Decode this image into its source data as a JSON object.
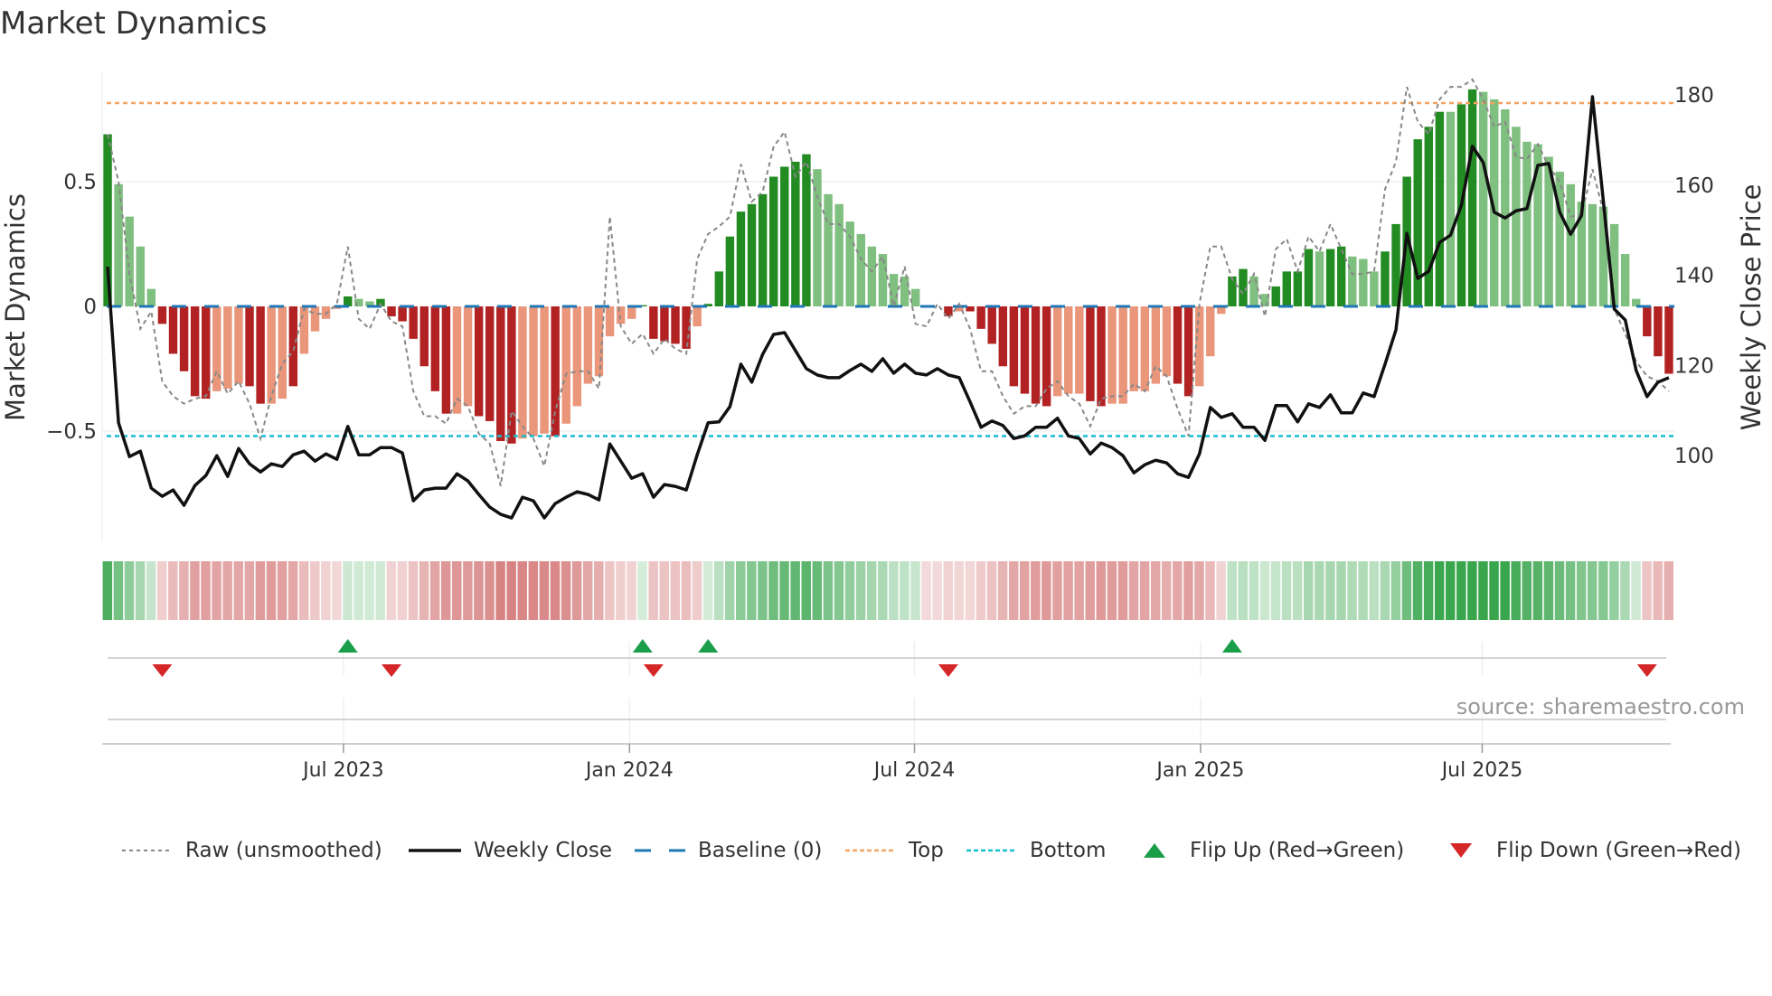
{
  "title": "Market Dynamics",
  "source": "source: sharemaestro.com",
  "legend": {
    "raw": "Raw (unsmoothed)",
    "close": "Weekly Close",
    "baseline": "Baseline (0)",
    "top": "Top",
    "bottom": "Bottom",
    "flip_up": "Flip Up (Red→Green)",
    "flip_down": "Flip Down (Green→Red)"
  },
  "colors": {
    "dark_green": "#228b22",
    "light_green": "#7fbf7f",
    "dark_red": "#b22222",
    "light_red": "#e9967a",
    "close": "#111111",
    "raw": "#888888",
    "baseline": "#1f77b4",
    "top": "#f4a460",
    "bottom": "#17becf",
    "flip_up": "#1a9e4a",
    "flip_down": "#d62728"
  },
  "chart_data": {
    "type": "bar",
    "title": "Market Dynamics",
    "ylabel": "Market Dynamics",
    "y2label": "Weekly Close Price",
    "ylim": [
      -0.94,
      0.93
    ],
    "y2lim": [
      81,
      185
    ],
    "yticks": [
      {
        "v": 0.5,
        "label": "0.5"
      },
      {
        "v": 0,
        "label": "0"
      },
      {
        "v": -0.5,
        "label": "−0.5"
      }
    ],
    "y2ticks": [
      {
        "v": 180,
        "label": "180"
      },
      {
        "v": 160,
        "label": "160"
      },
      {
        "v": 140,
        "label": "140"
      },
      {
        "v": 120,
        "label": "120"
      },
      {
        "v": 100,
        "label": "100"
      }
    ],
    "xticks": [
      {
        "week": 21.6,
        "label": "Jul 2023"
      },
      {
        "week": 47.8,
        "label": "Jan 2024"
      },
      {
        "week": 73.9,
        "label": "Jul 2024"
      },
      {
        "week": 100.1,
        "label": "Jan 2025"
      },
      {
        "week": 125.9,
        "label": "Jul 2025"
      }
    ],
    "top_level": 0.815,
    "bottom_level": -0.52,
    "baseline": 0,
    "momentum": [
      0.69,
      0.49,
      0.36,
      0.24,
      0.07,
      -0.07,
      -0.19,
      -0.26,
      -0.36,
      -0.37,
      -0.34,
      -0.33,
      -0.31,
      -0.32,
      -0.39,
      -0.39,
      -0.37,
      -0.32,
      -0.19,
      -0.1,
      -0.05,
      -0.01,
      0.04,
      0.03,
      0.02,
      0.03,
      -0.04,
      -0.06,
      -0.13,
      -0.24,
      -0.34,
      -0.43,
      -0.43,
      -0.4,
      -0.44,
      -0.46,
      -0.54,
      -0.55,
      -0.53,
      -0.52,
      -0.51,
      -0.52,
      -0.47,
      -0.4,
      -0.31,
      -0.28,
      -0.12,
      -0.07,
      -0.05,
      0.005,
      -0.13,
      -0.14,
      -0.15,
      -0.17,
      -0.08,
      0.01,
      0.14,
      0.28,
      0.38,
      0.41,
      0.45,
      0.52,
      0.56,
      0.58,
      0.61,
      0.55,
      0.45,
      0.41,
      0.34,
      0.29,
      0.24,
      0.21,
      0.13,
      0.12,
      0.07,
      0,
      0,
      -0.04,
      -0.02,
      -0.02,
      -0.09,
      -0.15,
      -0.24,
      -0.32,
      -0.35,
      -0.39,
      -0.4,
      -0.36,
      -0.35,
      -0.35,
      -0.38,
      -0.4,
      -0.39,
      -0.39,
      -0.34,
      -0.34,
      -0.31,
      -0.28,
      -0.31,
      -0.36,
      -0.32,
      -0.2,
      -0.03,
      0.12,
      0.15,
      0.12,
      0.05,
      0.08,
      0.14,
      0.14,
      0.23,
      0.22,
      0.23,
      0.24,
      0.2,
      0.19,
      0.14,
      0.22,
      0.33,
      0.52,
      0.67,
      0.72,
      0.78,
      0.78,
      0.81,
      0.87,
      0.86,
      0.83,
      0.79,
      0.72,
      0.66,
      0.65,
      0.6,
      0.54,
      0.49,
      0.42,
      0.41,
      0.4,
      0.33,
      0.21,
      0.03,
      -0.12,
      -0.2,
      -0.27
    ],
    "shade": "DLLLLDDDDDLLLDDLLDLLLLDLLDDDDDDDLLDDDDLLLDLLLLLLLDDDDDLDDDDDDDDDDLLLLLLLLLLDDDLDDDDDDDDLLLDDLLLLLLDDLLLDDLLDDDDLDDLLLDDDDDDLDDLLLLLLLLLLLLLLLDDD",
    "raw": [
      0.69,
      0.5,
      0.13,
      -0.09,
      -0.02,
      -0.3,
      -0.36,
      -0.39,
      -0.37,
      -0.36,
      -0.26,
      -0.35,
      -0.3,
      -0.39,
      -0.53,
      -0.36,
      -0.23,
      -0.18,
      -0.01,
      -0.03,
      -0.03,
      0.01,
      0.24,
      -0.05,
      -0.09,
      0.01,
      -0.06,
      -0.08,
      -0.34,
      -0.44,
      -0.44,
      -0.47,
      -0.37,
      -0.4,
      -0.51,
      -0.55,
      -0.72,
      -0.42,
      -0.48,
      -0.53,
      -0.64,
      -0.42,
      -0.27,
      -0.26,
      -0.26,
      -0.33,
      0.36,
      -0.08,
      -0.15,
      -0.11,
      -0.19,
      -0.13,
      -0.17,
      -0.19,
      0.19,
      0.29,
      0.32,
      0.36,
      0.57,
      0.42,
      0.46,
      0.64,
      0.7,
      0.52,
      0.58,
      0.44,
      0.33,
      0.33,
      0.28,
      0.19,
      0.14,
      0.2,
      0.0,
      0.16,
      -0.07,
      -0.08,
      0.01,
      -0.05,
      0.01,
      -0.09,
      -0.26,
      -0.26,
      -0.36,
      -0.43,
      -0.4,
      -0.4,
      -0.33,
      -0.3,
      -0.36,
      -0.39,
      -0.48,
      -0.37,
      -0.36,
      -0.36,
      -0.31,
      -0.34,
      -0.24,
      -0.28,
      -0.41,
      -0.52,
      0.01,
      0.24,
      0.24,
      0.11,
      0.05,
      0.13,
      -0.04,
      0.23,
      0.27,
      0.14,
      0.28,
      0.22,
      0.33,
      0.23,
      0.13,
      0.13,
      0.14,
      0.47,
      0.58,
      0.88,
      0.74,
      0.69,
      0.83,
      0.88,
      0.88,
      0.91,
      0.83,
      0.72,
      0.74,
      0.6,
      0.59,
      0.65,
      0.56,
      0.5,
      0.36,
      0.37,
      0.55,
      0.38,
      -0.01,
      -0.11,
      -0.22,
      -0.28,
      -0.3,
      -0.34
    ],
    "close": [
      141.9,
      107.3,
      99.8,
      101,
      92.8,
      91,
      92.4,
      89,
      93.4,
      95.6,
      100,
      95.4,
      101.6,
      98.2,
      96.4,
      98.2,
      97.6,
      100.2,
      101,
      98.8,
      100.4,
      99.2,
      106.5,
      100.2,
      100.2,
      101.8,
      101.8,
      100.6,
      90,
      92.4,
      92.8,
      92.8,
      96,
      94.4,
      91.4,
      88.6,
      87,
      86.2,
      90.8,
      90,
      86.2,
      89.4,
      90.8,
      92,
      91.4,
      90.2,
      102.6,
      98.8,
      95,
      96,
      90.8,
      93.6,
      93.2,
      92.4,
      100.2,
      107.3,
      107.5,
      110.9,
      120.3,
      116.3,
      122.5,
      126.9,
      127.3,
      123.3,
      119.3,
      117.9,
      117.3,
      117.3,
      118.9,
      120.3,
      118.7,
      121.5,
      118.3,
      120.3,
      118.3,
      117.9,
      119.3,
      117.9,
      117.3,
      111.9,
      106.3,
      107.7,
      106.7,
      103.8,
      104.4,
      106.3,
      106.3,
      108.3,
      104.4,
      103.8,
      100.4,
      102.8,
      101.8,
      100,
      96.2,
      98,
      99,
      98.4,
      96,
      95.2,
      100.4,
      110.7,
      108.5,
      109.3,
      106.3,
      106.3,
      103.4,
      111.1,
      111.1,
      107.5,
      111.5,
      110.7,
      113.5,
      109.5,
      109.5,
      113.9,
      113.1,
      120.3,
      127.9,
      149.3,
      139.3,
      140.9,
      147.3,
      148.9,
      155.6,
      168.6,
      165,
      154,
      152.7,
      154.3,
      154.8,
      164.4,
      164.8,
      154,
      149.1,
      153.3,
      179.6,
      156.4,
      132.5,
      130.1,
      118.9,
      113.1,
      116.3,
      117.3
    ],
    "flips_up": [
      22,
      49,
      55,
      103
    ],
    "flips_down": [
      5,
      26,
      50,
      77,
      141
    ]
  }
}
